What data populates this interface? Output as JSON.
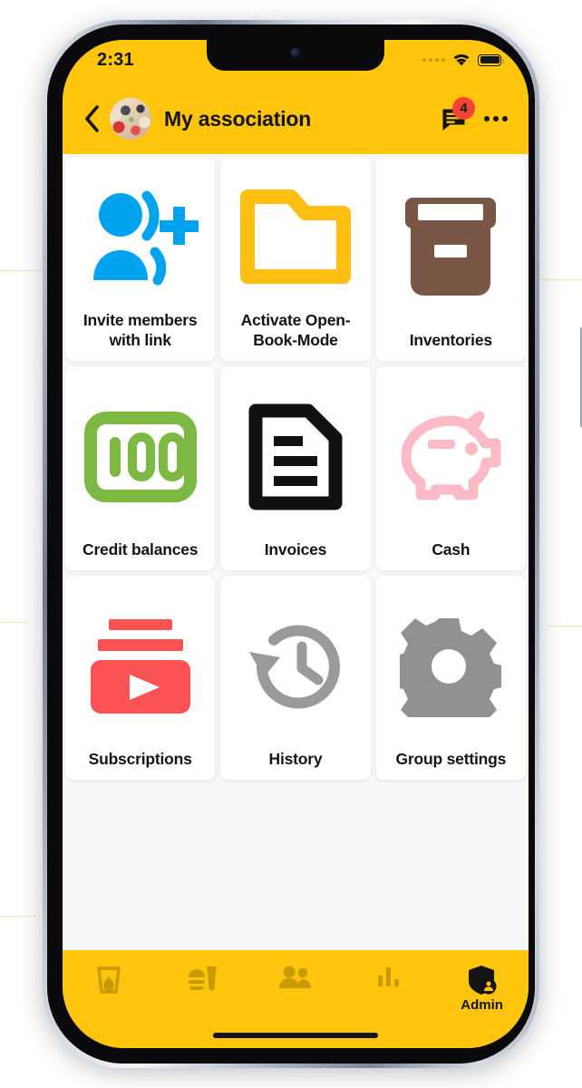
{
  "statusbar": {
    "time": "2:31",
    "signal_icon": "signal-dots-icon",
    "wifi_icon": "wifi-icon",
    "battery_icon": "battery-full-icon"
  },
  "header": {
    "back_icon": "chevron-left-icon",
    "avatar_name": "group-avatar",
    "title": "My association",
    "chat_icon": "chat-bubble-icon",
    "badge_count": "4",
    "more_icon": "more-horizontal-icon",
    "background_color": "#FEC50C"
  },
  "grid": {
    "tiles": [
      {
        "label": "Invite members with link",
        "icon": "person-add-icon",
        "color": "#00A3EE"
      },
      {
        "label": "Activate Open-Book-Mode",
        "icon": "folder-icon",
        "color": "#FEBF12"
      },
      {
        "label": "Inventories",
        "icon": "archive-box-icon",
        "color": "#7A5646"
      },
      {
        "label": "Credit balances",
        "icon": "banknote-100-icon",
        "color": "#7CB842"
      },
      {
        "label": "Invoices",
        "icon": "document-lines-icon",
        "color": "#111111"
      },
      {
        "label": "Cash",
        "icon": "piggy-bank-icon",
        "color": "#FBBAC6"
      },
      {
        "label": "Subscriptions",
        "icon": "subscriptions-play-icon",
        "color": "#FB5353"
      },
      {
        "label": "History",
        "icon": "history-clock-icon",
        "color": "#9A9A9A"
      },
      {
        "label": "Group settings",
        "icon": "gear-icon",
        "color": "#919191"
      }
    ]
  },
  "bottomnav": {
    "items": [
      {
        "label": "",
        "icon": "drink-glass-icon",
        "active": false
      },
      {
        "label": "",
        "icon": "food-meal-icon",
        "active": false
      },
      {
        "label": "",
        "icon": "people-icon",
        "active": false
      },
      {
        "label": "",
        "icon": "bar-chart-icon",
        "active": false
      },
      {
        "label": "Admin",
        "icon": "shield-person-icon",
        "active": true
      }
    ],
    "background_color": "#FEC50C"
  }
}
